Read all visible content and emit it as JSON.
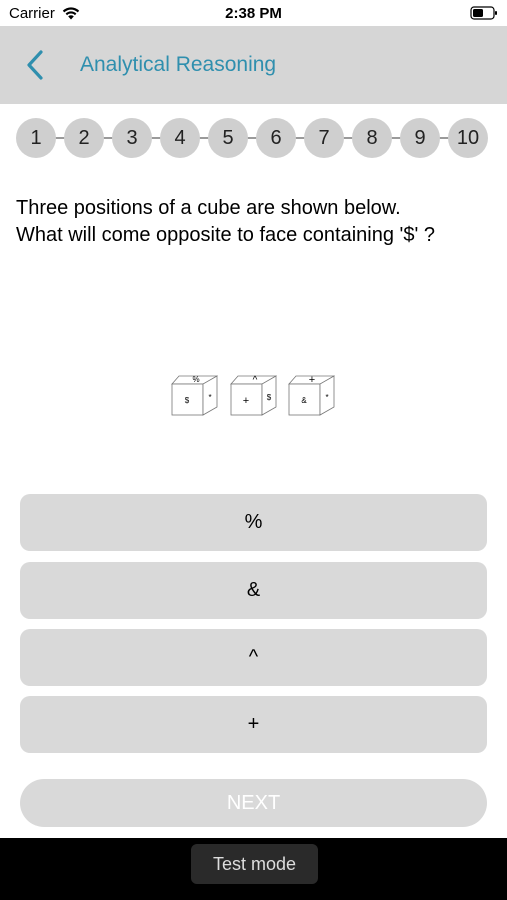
{
  "status_bar": {
    "carrier": "Carrier",
    "time": "2:38 PM"
  },
  "nav": {
    "title": "Analytical Reasoning",
    "back_icon": "chevron-left-icon"
  },
  "pager": {
    "numbers": [
      "1",
      "2",
      "3",
      "4",
      "5",
      "6",
      "7",
      "8",
      "9",
      "10"
    ]
  },
  "question": {
    "line1": "Three positions of a cube are shown below.",
    "line2": "What will come opposite to face containing '$' ?"
  },
  "cubes": [
    {
      "top": "%",
      "front": "$",
      "side": "*"
    },
    {
      "top": "^",
      "front": "+",
      "side": "$"
    },
    {
      "top": "+",
      "front": "&",
      "side": "*"
    }
  ],
  "options": [
    "%",
    "&",
    "^",
    "+"
  ],
  "next_label": "NEXT",
  "bottom": {
    "test_mode": "Test mode"
  },
  "colors": {
    "accent": "#2f8fae",
    "nav_bg": "#d6d6d6",
    "option_bg": "#d9d9d9",
    "pager_circle": "#cfcfcf"
  }
}
